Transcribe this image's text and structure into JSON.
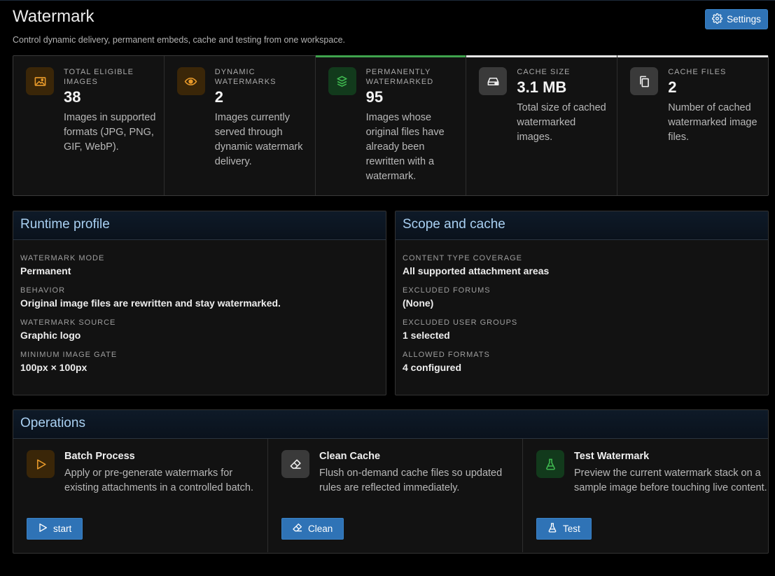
{
  "header": {
    "title": "Watermark",
    "description": "Control dynamic delivery, permanent embeds, cache and testing from one workspace.",
    "settings_label": "Settings"
  },
  "stats": [
    {
      "label": "TOTAL ELIGIBLE IMAGES",
      "value": "38",
      "desc": "Images in supported formats (JPG, PNG, GIF, WebP).",
      "icon": "image-icon",
      "accent": "#e89a2a",
      "bar": ""
    },
    {
      "label": "DYNAMIC WATERMARKS",
      "value": "2",
      "desc": "Images currently served through dynamic watermark delivery.",
      "icon": "eye-icon",
      "accent": "#e89a2a",
      "bar": ""
    },
    {
      "label": "PERMANENTLY WATERMARKED",
      "value": "95",
      "desc": "Images whose original files have already been rewritten with a watermark.",
      "icon": "layers-icon",
      "accent": "#3fb950",
      "bar": "#3fa34d"
    },
    {
      "label": "CACHE SIZE",
      "value": "3.1 MB",
      "desc": "Total size of cached watermarked images.",
      "icon": "hard-drive-icon",
      "accent": "#e6e6e6",
      "bar": "#e6e6e6"
    },
    {
      "label": "CACHE FILES",
      "value": "2",
      "desc": "Number of cached watermarked image files.",
      "icon": "files-icon",
      "accent": "#e6e6e6",
      "bar": "#e6e6e6"
    }
  ],
  "runtime": {
    "title": "Runtime profile",
    "items": [
      {
        "key": "WATERMARK MODE",
        "value": "Permanent"
      },
      {
        "key": "BEHAVIOR",
        "value": "Original image files are rewritten and stay watermarked."
      },
      {
        "key": "WATERMARK SOURCE",
        "value": "Graphic logo"
      },
      {
        "key": "MINIMUM IMAGE GATE",
        "value": "100px × 100px"
      }
    ]
  },
  "scope": {
    "title": "Scope and cache",
    "items": [
      {
        "key": "CONTENT TYPE COVERAGE",
        "value": "All supported attachment areas"
      },
      {
        "key": "EXCLUDED FORUMS",
        "value": "(None)"
      },
      {
        "key": "EXCLUDED USER GROUPS",
        "value": "1 selected"
      },
      {
        "key": "ALLOWED FORMATS",
        "value": "4 configured"
      }
    ]
  },
  "operations": {
    "title": "Operations",
    "items": [
      {
        "title": "Batch Process",
        "desc": "Apply or pre-generate watermarks for existing attachments in a controlled batch.",
        "button": "start",
        "icon": "play-icon",
        "accent": "#e89a2a"
      },
      {
        "title": "Clean Cache",
        "desc": "Flush on-demand cache files so updated rules are reflected immediately.",
        "button": "Clean",
        "icon": "eraser-icon",
        "accent": "#e6e6e6"
      },
      {
        "title": "Test Watermark",
        "desc": "Preview the current watermark stack on a sample image before touching live content.",
        "button": "Test",
        "icon": "flask-icon",
        "accent": "#3fb950"
      }
    ]
  }
}
